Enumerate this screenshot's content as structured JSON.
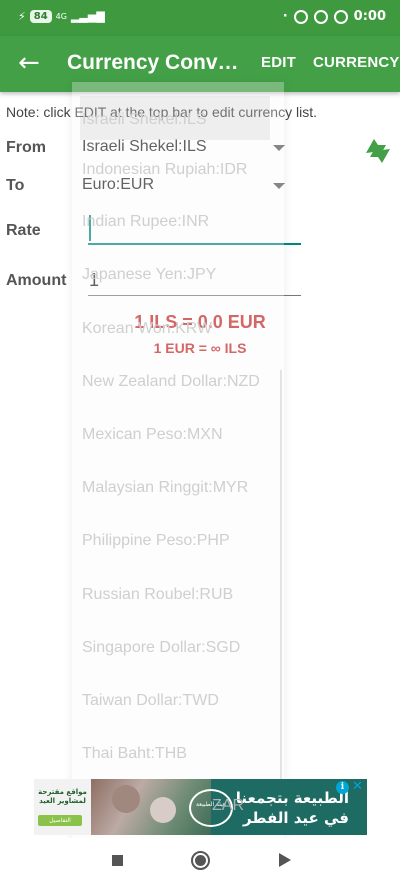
{
  "status_bar": {
    "battery": "84",
    "network": "4G",
    "time": "0:00"
  },
  "app_bar": {
    "title": "Currency Converter",
    "edit_label": "EDIT",
    "currency_label": "CURRENCY"
  },
  "note": "Note: click EDIT at the top bar to edit currency list.",
  "form": {
    "from_label": "From",
    "from_value": "Israeli Shekel:ILS",
    "to_label": "To",
    "to_value": "Euro:EUR",
    "rate_label": "Rate",
    "rate_value": "",
    "amount_label": "Amount",
    "amount_value": "1"
  },
  "result": {
    "main": "1 ILS = 0.0 EUR",
    "inverse": "1 EUR = ∞ ILS"
  },
  "dropdown_items": [
    "Israeli Shekel:ILS",
    "Indonesian Rupiah:IDR",
    "Indian Rupee:INR",
    "Japanese Yen:JPY",
    "Korean Won:KRW",
    "New Zealand Dollar:NZD",
    "Mexican Peso:MXN",
    "Malaysian Ringgit:MYR",
    "Philippine Peso:PHP",
    "Russian Roubel:RUB",
    "Singapore Dollar:SGD",
    "Taiwan Dollar:TWD",
    "Thai Baht:THB",
    "ZAR"
  ],
  "ad": {
    "left_text": "مواقع مقترحة لمشاوير العيد",
    "left_button": "التفاصيل",
    "logo_text": "هيئة الطبيعة",
    "headline": "الطبيعة بتجمعنا في عيد الفطر"
  },
  "colors": {
    "app_bar": "#43a047",
    "status_bar": "#3f9a3f",
    "accent": "#00897b",
    "result": "#c62828"
  },
  "icons": {
    "back": "arrow-left-icon",
    "swap": "swap-arrows-icon",
    "nav_recents": "square-icon",
    "nav_home": "circle-icon",
    "nav_back": "triangle-icon"
  }
}
